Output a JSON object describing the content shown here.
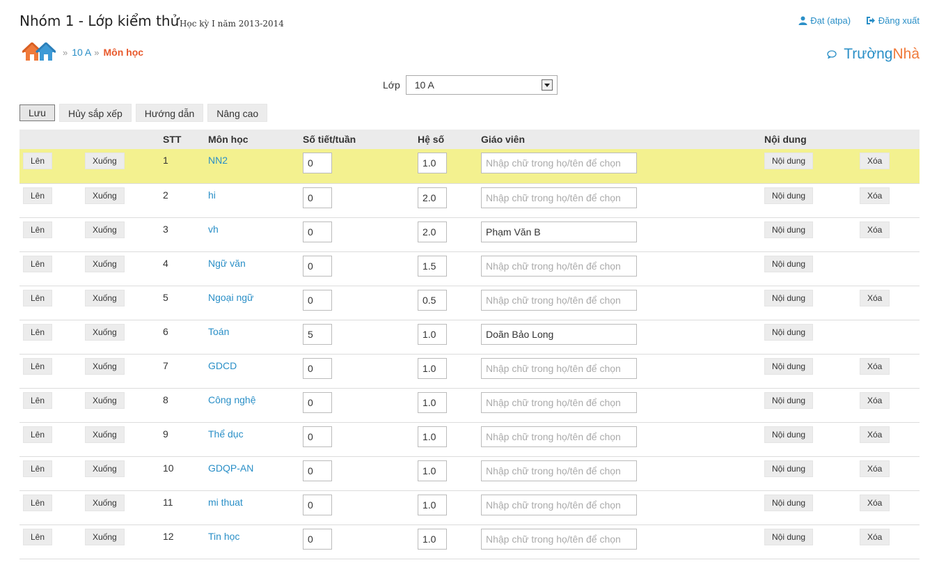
{
  "header": {
    "title": "Nhóm 1 - Lớp kiểm thử",
    "semester": "Học kỳ I năm 2013-2014",
    "user": "Đạt (atpa)",
    "logout": "Đăng xuất"
  },
  "breadcrumb": {
    "sep": "»",
    "class_link": "10 A",
    "current": "Môn học"
  },
  "brand": {
    "part1": "Trường",
    "part2": "Nhà"
  },
  "class_select": {
    "label": "Lớp",
    "value": "10 A"
  },
  "toolbar": {
    "save": "Lưu",
    "cancel_sort": "Hủy sắp xếp",
    "guide": "Hướng dẫn",
    "advanced": "Nâng cao"
  },
  "table": {
    "headers": {
      "stt": "STT",
      "subject": "Môn học",
      "periods": "Số tiết/tuần",
      "coef": "Hệ số",
      "teacher": "Giáo viên",
      "content": "Nội dung"
    },
    "up_label": "Lên",
    "down_label": "Xuống",
    "content_label": "Nội dung",
    "delete_label": "Xóa",
    "teacher_placeholder": "Nhập chữ trong họ/tên để chọn",
    "rows": [
      {
        "stt": "1",
        "subject": "NN2",
        "periods": "0",
        "coef": "1.0",
        "teacher": "",
        "delete": true
      },
      {
        "stt": "2",
        "subject": "hi",
        "periods": "0",
        "coef": "2.0",
        "teacher": "",
        "delete": true
      },
      {
        "stt": "3",
        "subject": "vh",
        "periods": "0",
        "coef": "2.0",
        "teacher": "Phạm Văn B",
        "delete": true
      },
      {
        "stt": "4",
        "subject": "Ngữ văn",
        "periods": "0",
        "coef": "1.5",
        "teacher": "",
        "delete": false
      },
      {
        "stt": "5",
        "subject": "Ngoại ngữ",
        "periods": "0",
        "coef": "0.5",
        "teacher": "",
        "delete": true
      },
      {
        "stt": "6",
        "subject": "Toán",
        "periods": "5",
        "coef": "1.0",
        "teacher": "Doãn Bảo Long",
        "delete": false
      },
      {
        "stt": "7",
        "subject": "GDCD",
        "periods": "0",
        "coef": "1.0",
        "teacher": "",
        "delete": true
      },
      {
        "stt": "8",
        "subject": "Công nghệ",
        "periods": "0",
        "coef": "1.0",
        "teacher": "",
        "delete": true
      },
      {
        "stt": "9",
        "subject": "Thể dục",
        "periods": "0",
        "coef": "1.0",
        "teacher": "",
        "delete": true
      },
      {
        "stt": "10",
        "subject": "GDQP-AN",
        "periods": "0",
        "coef": "1.0",
        "teacher": "",
        "delete": true
      },
      {
        "stt": "11",
        "subject": "mi thuat",
        "periods": "0",
        "coef": "1.0",
        "teacher": "",
        "delete": true
      },
      {
        "stt": "12",
        "subject": "Tin học",
        "periods": "0",
        "coef": "1.0",
        "teacher": "",
        "delete": true
      }
    ]
  },
  "colors": {
    "link": "#2a8fc7",
    "accent": "#e8592c",
    "highlight_row": "#f3f18f"
  }
}
